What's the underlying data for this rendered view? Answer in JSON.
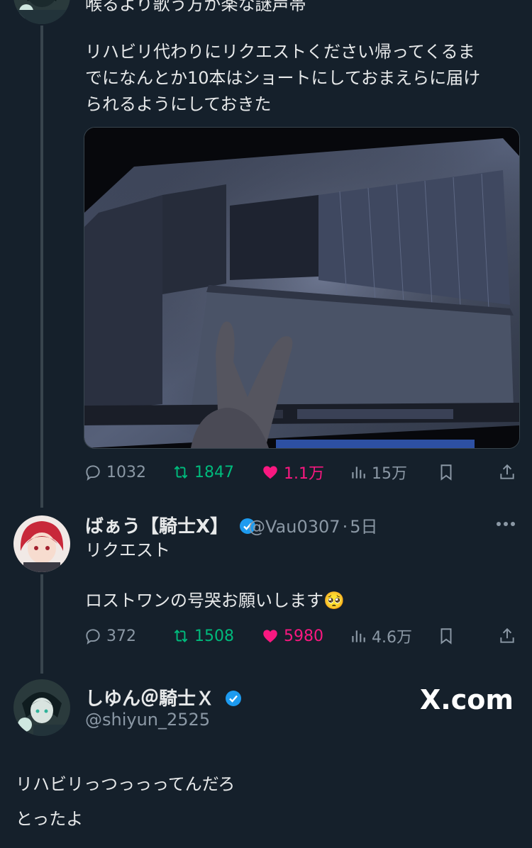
{
  "post1": {
    "text_top": "喉るより歌う方が楽な謎声帯",
    "text_lines": [
      "リハビリ代わりにリクエストください帰ってくるま",
      "でになんとか10本はショートにしておまえらに届け",
      "られるようにしておきた"
    ],
    "media_alt": "DAW screen with peace sign",
    "stats": {
      "replies": "1032",
      "retweets": "1847",
      "likes": "1.1万",
      "views": "15万"
    }
  },
  "reply": {
    "name": "ばぁう【騎士X】",
    "handle": "@Vau0307",
    "separator": "·",
    "time": "5日",
    "line1": "リクエスト",
    "line2": "ロストワンの号哭お願いします🥺",
    "stats": {
      "replies": "372",
      "retweets": "1508",
      "likes": "5980",
      "views": "4.6万"
    }
  },
  "quote": {
    "name": "しゆん＠騎士Ｘ",
    "handle": "@shiyun_2525",
    "brand": "X.com",
    "line1": "リハビリっつっっってんだろ",
    "line2": "とったよ"
  },
  "colors": {
    "background": "#15202b",
    "muted": "#8b98a5",
    "retweet": "#00ba7c",
    "like": "#f91880",
    "verified": "#1d9bf0"
  },
  "icons": [
    "reply-icon",
    "retweet-icon",
    "heart-icon",
    "views-icon",
    "bookmark-icon",
    "share-icon",
    "more-icon",
    "verified-icon"
  ]
}
